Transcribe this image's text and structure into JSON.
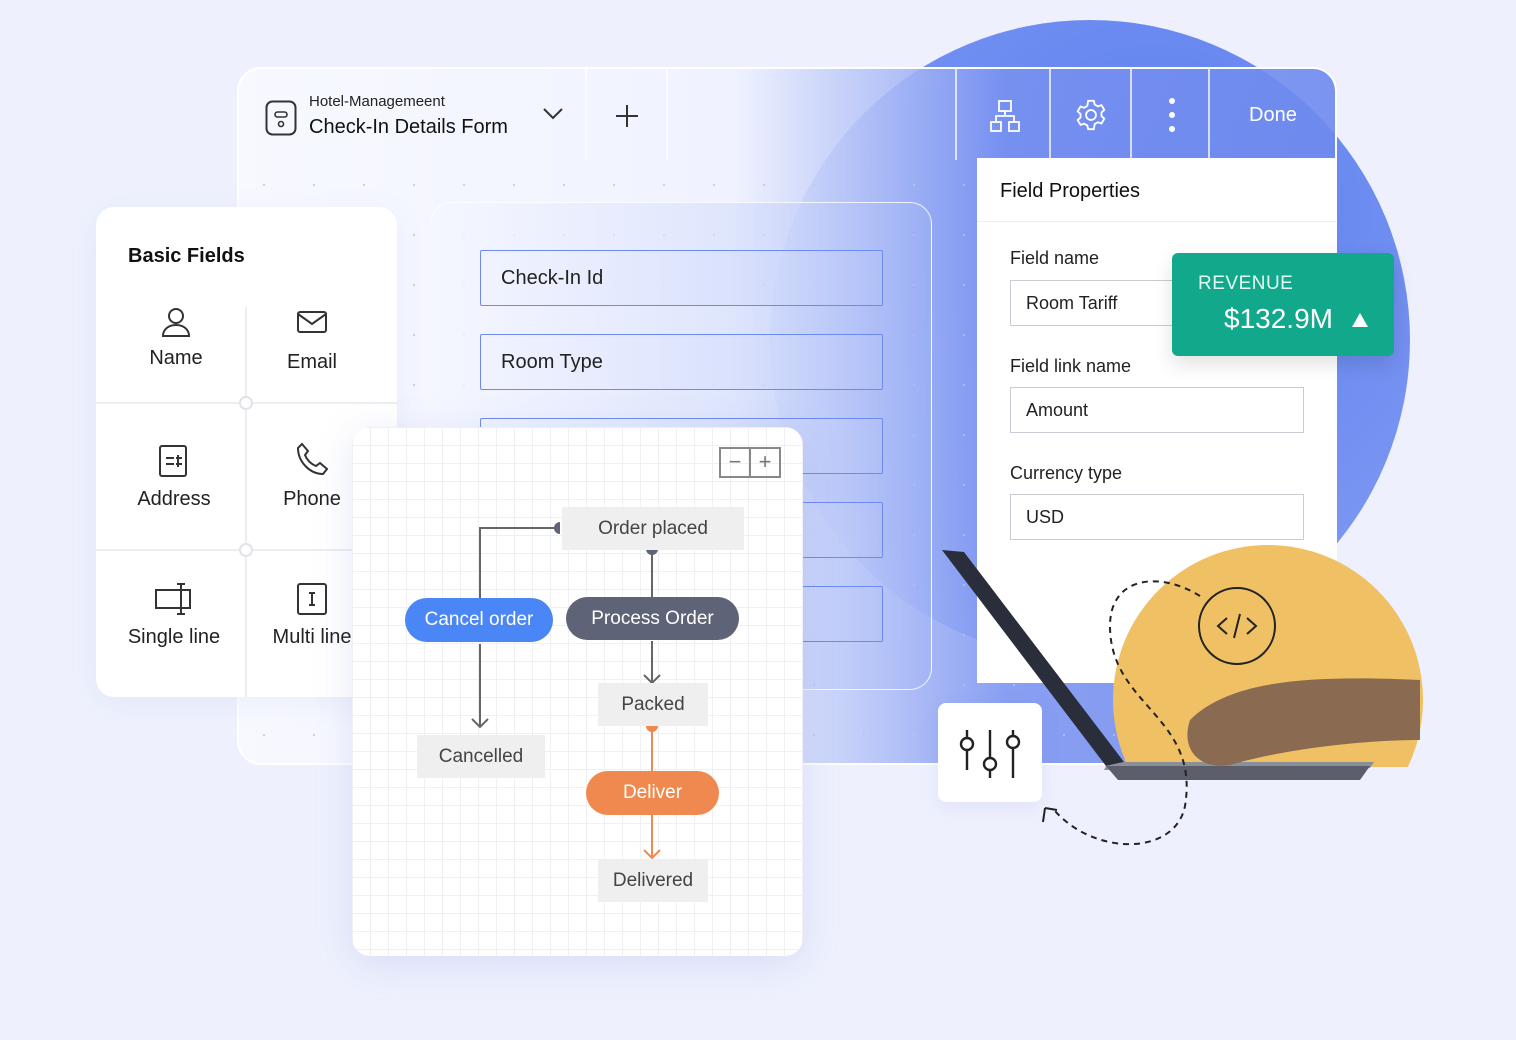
{
  "header": {
    "app_name": "Hotel-Managemeent",
    "form_title": "Check-In Details Form",
    "done_label": "Done"
  },
  "basic_fields": {
    "title": "Basic Fields",
    "items": [
      {
        "label": "Name",
        "icon": "user-icon"
      },
      {
        "label": "Email",
        "icon": "mail-icon"
      },
      {
        "label": "Address",
        "icon": "address-icon"
      },
      {
        "label": "Phone",
        "icon": "phone-icon"
      },
      {
        "label": "Single line",
        "icon": "single-line-icon"
      },
      {
        "label": "Multi line",
        "icon": "multi-line-icon"
      }
    ]
  },
  "form": {
    "fields": [
      "Check-In Id",
      "Room Type",
      "",
      "",
      ""
    ]
  },
  "field_properties": {
    "title": "Field Properties",
    "field_name_label": "Field name",
    "field_name_value": "Room Tariff",
    "link_name_label": "Field link name",
    "link_name_value": "Amount",
    "currency_label": "Currency type",
    "currency_value": "USD"
  },
  "revenue": {
    "label": "REVENUE",
    "value": "$132.9M",
    "trend": "up",
    "color": "#12a88b"
  },
  "workflow": {
    "zoom_out": "−",
    "zoom_in": "+",
    "states": {
      "order_placed": "Order placed",
      "packed": "Packed",
      "cancelled": "Cancelled",
      "delivered": "Delivered"
    },
    "actions": {
      "cancel": "Cancel order",
      "process": "Process Order",
      "deliver": "Deliver"
    },
    "colors": {
      "cancel": "#4a86f5",
      "process": "#5f6378",
      "deliver": "#f0894f"
    }
  }
}
